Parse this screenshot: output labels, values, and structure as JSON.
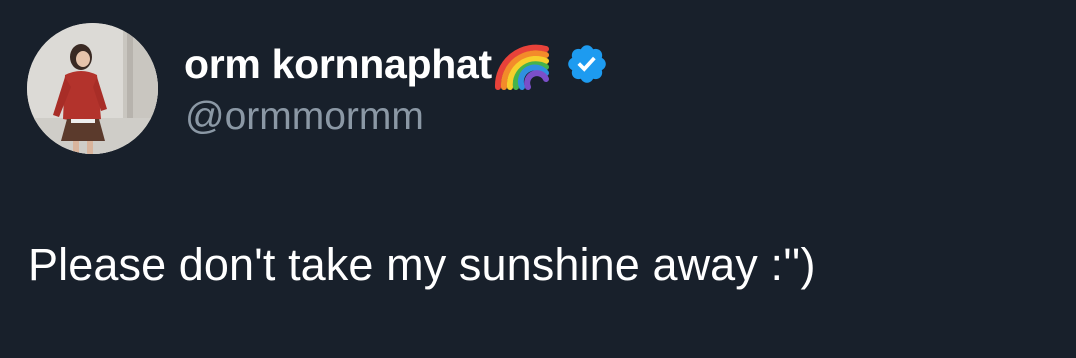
{
  "author": {
    "display_name": "orm kornnaphat",
    "handle": "@ormmormm",
    "name_emoji": "rainbow-icon",
    "verified_badge": "verified-icon"
  },
  "tweet": {
    "text": "Please don't take my sunshine away :'')"
  },
  "colors": {
    "background": "#18202b",
    "name_text": "#ffffff",
    "handle_text": "#8b98a5",
    "verified_blue": "#1d9bf0"
  }
}
